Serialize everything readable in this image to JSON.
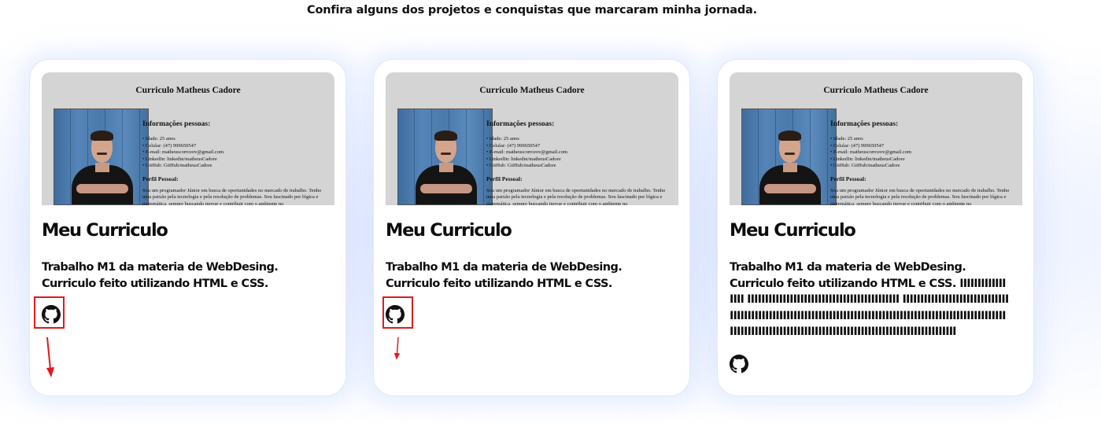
{
  "page": {
    "subtitle": "Confira alguns dos projetos e conquistas que marcaram minha jornada."
  },
  "colors": {
    "annotation_red": "#e21a1a",
    "card_shadow": "#d6e1ff",
    "thumbnail_bg": "#d4d4d4"
  },
  "projects": [
    {
      "title": "Meu Curriculo",
      "description_lines": [
        "Trabalho M1 da materia de WebDesing.",
        "Curriculo feito utilizando HTML e CSS."
      ],
      "extra_text": "",
      "link_icon": "github-icon",
      "highlighted": true,
      "thumbnail": {
        "heading": "Curriculo Matheus Cadore",
        "section": "Informações pessoas:",
        "items": [
          "• Idade: 25 anos",
          "• Celular: (47) 999650547",
          "• E-mail: matheuscorrceov@gmail.com",
          "• LinkedIn: linkedin/matheusCadore",
          "• GitHub: GitHub/matheusCadore"
        ],
        "profile_heading": "Perfil Pessoal:",
        "profile_text": "Sou um programador Júnior em busca de oportunidades no mercado de trabalho. Tenho uma paixão pela tecnologia e pela resolução de problemas. Sou fascinado por lógica e matemática, sempre buscando inovar e contribuir com o ambiente no"
      }
    },
    {
      "title": "Meu Curriculo",
      "description_lines": [
        "Trabalho M1 da materia de WebDesing.",
        "Curriculo feito utilizando HTML e CSS."
      ],
      "extra_text": "",
      "link_icon": "github-icon",
      "highlighted": true,
      "thumbnail": {
        "heading": "Curriculo Matheus Cadore",
        "section": "Informações pessoas:",
        "items": [
          "• Idade: 25 anos",
          "• Celular: (47) 999650547",
          "• E-mail: matheuscorrceov@gmail.com",
          "• LinkedIn: linkedin/matheusCadore",
          "• GitHub: GitHub/matheusCadore"
        ],
        "profile_heading": "Perfil Pessoal:",
        "profile_text": "Sou um programador Júnior em busca de oportunidades no mercado de trabalho. Tenho uma paixão pela tecnologia e pela resolução de problemas. Sou fascinado por lógica e matemática, sempre buscando inovar e contribuir com o ambiente no"
      }
    },
    {
      "title": "Meu Curriculo",
      "description_lines": [
        "Trabalho M1 da materia de WebDesing.",
        "Curriculo feito utilizando HTML e CSS."
      ],
      "extra_text": "IIIIIIIIIIIIIIIII IIIIIIIIIIIIIIIIIIIIIIIIIIIIIIIIIIIIIIIIIII IIIIIIIIIIIIIIIIIIIIIIIIIIIIIIIIIIIIIIIIIIIIIIIIIIIIIIIIIIIIIIIIIIIIIIIIIIIIIIIIIIIIIIIIIIIIIIIIIIIIIIIIIIIIIIIIIIIIIIIIIIIIIIIIIIIIIIIIIIIIIIIIIIIIIIIIIIIIIIIIIIIIIIIIIIII",
      "link_icon": "github-icon",
      "highlighted": false,
      "thumbnail": {
        "heading": "Curriculo Matheus Cadore",
        "section": "Informações pessoas:",
        "items": [
          "• Idade: 25 anos",
          "• Celular: (47) 999650547",
          "• E-mail: matheuscorrceov@gmail.com",
          "• LinkedIn: linkedin/matheusCadore",
          "• GitHub: GitHub/matheusCadore"
        ],
        "profile_heading": "Perfil Pessoal:",
        "profile_text": "Sou um programador Júnior em busca de oportunidades no mercado de trabalho. Tenho uma paixão pela tecnologia e pela resolução de problemas. Sou fascinado por lógica e matemática, sempre buscando inovar e contribuir com o ambiente no"
      }
    }
  ]
}
